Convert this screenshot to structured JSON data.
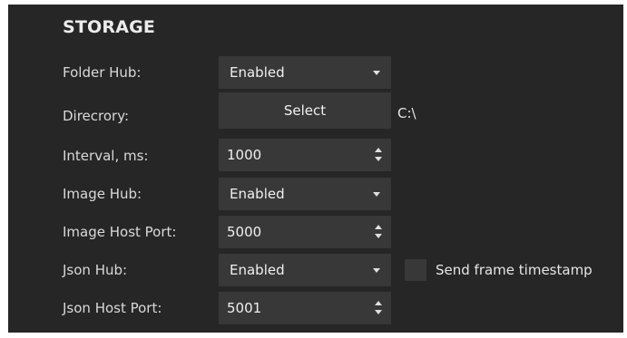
{
  "section": {
    "title": "STORAGE"
  },
  "rows": {
    "folder_hub": {
      "label": "Folder Hub:",
      "value": "Enabled"
    },
    "directory": {
      "label": "Direcrory:",
      "button_label": "Select",
      "path": "C:\\"
    },
    "interval": {
      "label": "Interval, ms:",
      "value": "1000"
    },
    "image_hub": {
      "label": "Image Hub:",
      "value": "Enabled"
    },
    "image_host_port": {
      "label": "Image Host Port:",
      "value": "5000"
    },
    "json_hub": {
      "label": "Json Hub:",
      "value": "Enabled"
    },
    "json_host_port": {
      "label": "Json Host Port:",
      "value": "5001"
    }
  },
  "send_frame_timestamp": {
    "label": "Send frame timestamp",
    "checked": false
  },
  "colors": {
    "panel_background": "#262626",
    "control_background": "#383838",
    "text": "#e6e6e6"
  },
  "icons": {
    "dropdown": "caret-down-icon",
    "spinner": "spinner-arrows-icon"
  }
}
